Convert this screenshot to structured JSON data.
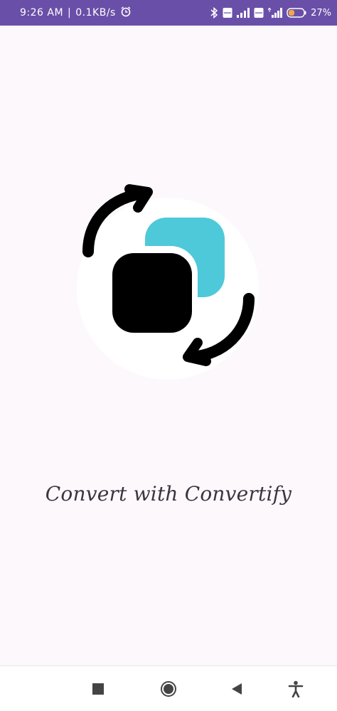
{
  "status_bar": {
    "time": "9:26 AM",
    "network_speed": "0.1KB/s",
    "battery": "27%",
    "icons": [
      "alarm-icon",
      "bluetooth-icon",
      "volte-icon",
      "signal-icon",
      "volte-icon",
      "signal-icon",
      "battery-icon"
    ]
  },
  "splash": {
    "tagline": "Convert with Convertify",
    "logo_colors": {
      "primary": "#000000",
      "accent": "#4ec9d9"
    }
  },
  "nav_bar": {
    "buttons": [
      "recents-icon",
      "home-icon",
      "back-icon",
      "accessibility-icon"
    ]
  },
  "theme": {
    "status_bar_color": "#6a4fa8",
    "background": "#fdf8fc",
    "text_color": "#3a3540"
  }
}
